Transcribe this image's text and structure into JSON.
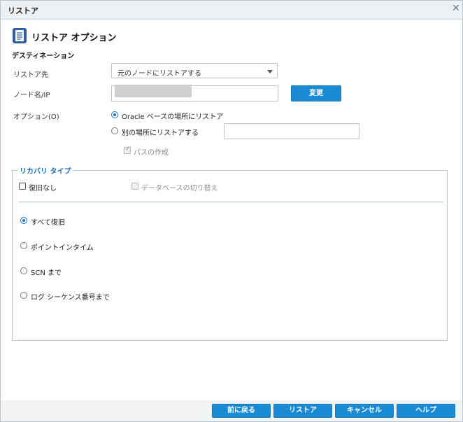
{
  "window": {
    "title": "リストア",
    "close_glyph": "✕"
  },
  "header": {
    "title": "リストア オプション",
    "icon": "document-icon"
  },
  "destination": {
    "section_label": "デスティネーション",
    "restore_to_label": "リストア先",
    "restore_to_value": "元のノードにリストアする",
    "node_label": "ノード名/IP",
    "change_button": "変更",
    "options_label": "オプション(O)",
    "option_oracle": "Oracle ベースの場所にリストア",
    "option_alternate": "別の場所にリストアする",
    "create_path": "パスの作成"
  },
  "recovery": {
    "legend": "リカバリ タイプ",
    "no_recovery": "復旧なし",
    "switch_db": "データベースの切り替え",
    "recover_all": "すべて復旧",
    "point_in_time": "ポイントインタイム",
    "until_scn": "SCN まで",
    "until_log_seq": "ログ シーケンス番号まで"
  },
  "footer": {
    "back": "前に戻る",
    "restore": "リストア",
    "cancel": "キャンセル",
    "help": "ヘルプ"
  },
  "colors": {
    "accent": "#1a8ad4",
    "legend": "#1a6db5"
  }
}
